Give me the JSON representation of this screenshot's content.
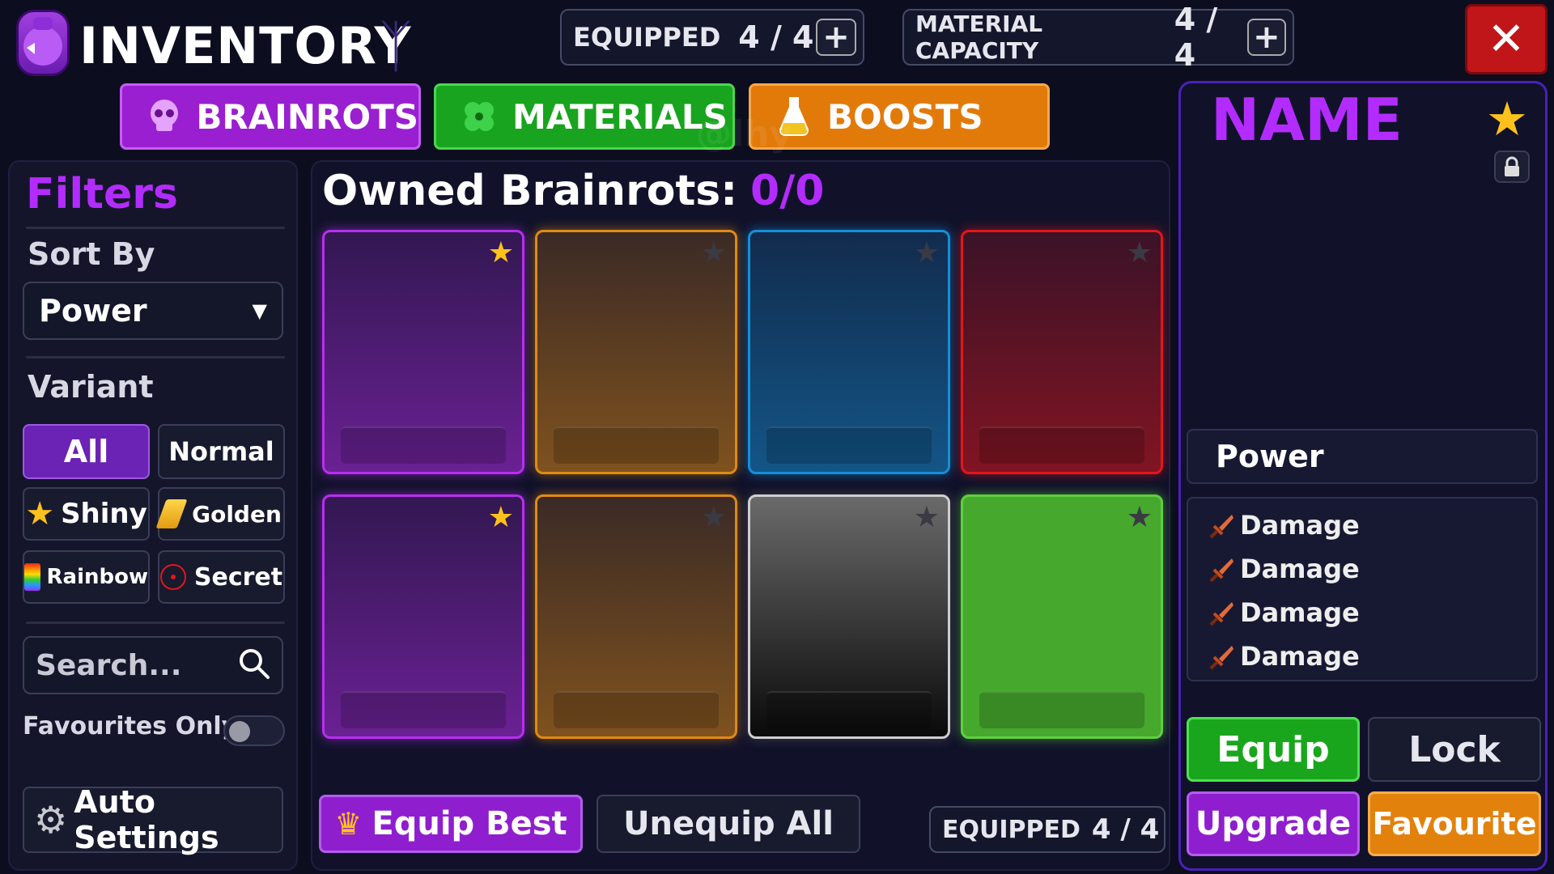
{
  "header": {
    "title": "INVENTORY",
    "crest": "ᛉ",
    "equipped": {
      "label": "EQUIPPED",
      "value": "4 / 4"
    },
    "material_capacity": {
      "label": "MATERIAL CAPACITY",
      "value": "4 / 4"
    },
    "plus_label": "+",
    "close_label": "✕"
  },
  "tabs": [
    {
      "label": "BRAINROTS",
      "icon": "skull-icon",
      "color": "#9a1fd1"
    },
    {
      "label": "MATERIALS",
      "icon": "clover-icon",
      "color": "#18a41e"
    },
    {
      "label": "BOOSTS",
      "icon": "potion-icon",
      "color": "#e27a0a"
    }
  ],
  "watermark": "@lhy",
  "filters": {
    "title": "Filters",
    "sort_label": "Sort By",
    "sort_value": "Power",
    "variant_label": "Variant",
    "variants": [
      "All",
      "Normal",
      "Shiny",
      "Golden",
      "Rainbow",
      "Secret"
    ],
    "selected_variant": "All",
    "search_placeholder": "Search...",
    "favourites_label": "Favourites Only",
    "favourites_on": false,
    "auto_settings_label": "Auto Settings"
  },
  "main": {
    "owned_label": "Owned Brainrots:",
    "owned_count": "0/0",
    "cards": [
      {
        "rarity_color": "#b82ef0",
        "starred": true
      },
      {
        "rarity_color": "#e08a14",
        "starred": false
      },
      {
        "rarity_color": "#1590d8",
        "starred": false
      },
      {
        "rarity_color": "#e3161b",
        "starred": false
      },
      {
        "rarity_color": "#b82ef0",
        "starred": true
      },
      {
        "rarity_color": "#e08a14",
        "starred": false
      },
      {
        "rarity_color": "#5a5a5a",
        "starred": false
      },
      {
        "rarity_color": "#5fcf40",
        "starred": false
      }
    ],
    "equip_best_label": "Equip Best",
    "unequip_all_label": "Unequip All",
    "equipped_footer": {
      "label": "EQUIPPED",
      "value": "4 / 4"
    }
  },
  "detail": {
    "name": "NAME",
    "power_label": "Power",
    "stats": [
      "Damage",
      "Damage",
      "Damage",
      "Damage"
    ],
    "equip_label": "Equip",
    "lock_label": "Lock",
    "upgrade_label": "Upgrade",
    "favourite_label": "Favourite"
  },
  "colors": {
    "accent_purple": "#b32cff",
    "green": "#19a61d",
    "orange": "#e2820c",
    "close_red": "#c0161a"
  }
}
